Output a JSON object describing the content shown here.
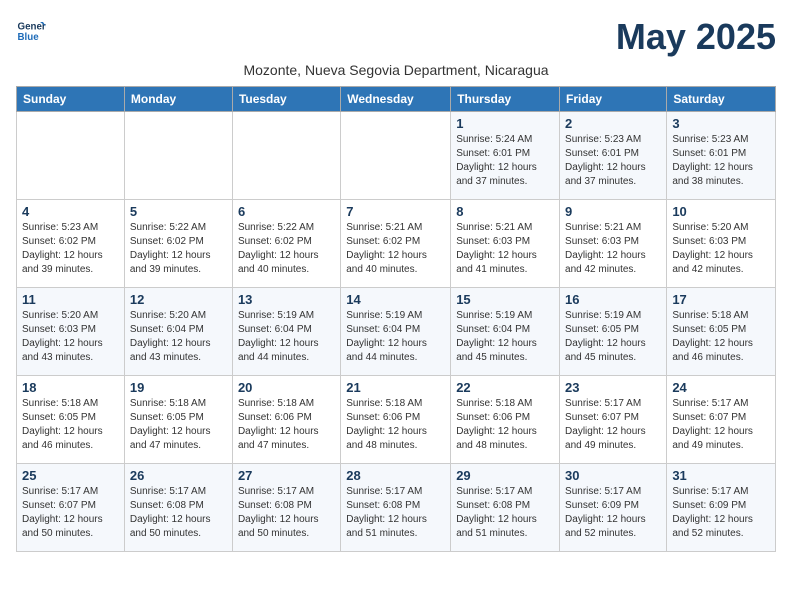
{
  "logo": {
    "line1": "General",
    "line2": "Blue"
  },
  "title": "May 2025",
  "subtitle": "Mozonte, Nueva Segovia Department, Nicaragua",
  "days_of_week": [
    "Sunday",
    "Monday",
    "Tuesday",
    "Wednesday",
    "Thursday",
    "Friday",
    "Saturday"
  ],
  "weeks": [
    [
      {
        "day": "",
        "info": ""
      },
      {
        "day": "",
        "info": ""
      },
      {
        "day": "",
        "info": ""
      },
      {
        "day": "",
        "info": ""
      },
      {
        "day": "1",
        "info": "Sunrise: 5:24 AM\nSunset: 6:01 PM\nDaylight: 12 hours\nand 37 minutes."
      },
      {
        "day": "2",
        "info": "Sunrise: 5:23 AM\nSunset: 6:01 PM\nDaylight: 12 hours\nand 37 minutes."
      },
      {
        "day": "3",
        "info": "Sunrise: 5:23 AM\nSunset: 6:01 PM\nDaylight: 12 hours\nand 38 minutes."
      }
    ],
    [
      {
        "day": "4",
        "info": "Sunrise: 5:23 AM\nSunset: 6:02 PM\nDaylight: 12 hours\nand 39 minutes."
      },
      {
        "day": "5",
        "info": "Sunrise: 5:22 AM\nSunset: 6:02 PM\nDaylight: 12 hours\nand 39 minutes."
      },
      {
        "day": "6",
        "info": "Sunrise: 5:22 AM\nSunset: 6:02 PM\nDaylight: 12 hours\nand 40 minutes."
      },
      {
        "day": "7",
        "info": "Sunrise: 5:21 AM\nSunset: 6:02 PM\nDaylight: 12 hours\nand 40 minutes."
      },
      {
        "day": "8",
        "info": "Sunrise: 5:21 AM\nSunset: 6:03 PM\nDaylight: 12 hours\nand 41 minutes."
      },
      {
        "day": "9",
        "info": "Sunrise: 5:21 AM\nSunset: 6:03 PM\nDaylight: 12 hours\nand 42 minutes."
      },
      {
        "day": "10",
        "info": "Sunrise: 5:20 AM\nSunset: 6:03 PM\nDaylight: 12 hours\nand 42 minutes."
      }
    ],
    [
      {
        "day": "11",
        "info": "Sunrise: 5:20 AM\nSunset: 6:03 PM\nDaylight: 12 hours\nand 43 minutes."
      },
      {
        "day": "12",
        "info": "Sunrise: 5:20 AM\nSunset: 6:04 PM\nDaylight: 12 hours\nand 43 minutes."
      },
      {
        "day": "13",
        "info": "Sunrise: 5:19 AM\nSunset: 6:04 PM\nDaylight: 12 hours\nand 44 minutes."
      },
      {
        "day": "14",
        "info": "Sunrise: 5:19 AM\nSunset: 6:04 PM\nDaylight: 12 hours\nand 44 minutes."
      },
      {
        "day": "15",
        "info": "Sunrise: 5:19 AM\nSunset: 6:04 PM\nDaylight: 12 hours\nand 45 minutes."
      },
      {
        "day": "16",
        "info": "Sunrise: 5:19 AM\nSunset: 6:05 PM\nDaylight: 12 hours\nand 45 minutes."
      },
      {
        "day": "17",
        "info": "Sunrise: 5:18 AM\nSunset: 6:05 PM\nDaylight: 12 hours\nand 46 minutes."
      }
    ],
    [
      {
        "day": "18",
        "info": "Sunrise: 5:18 AM\nSunset: 6:05 PM\nDaylight: 12 hours\nand 46 minutes."
      },
      {
        "day": "19",
        "info": "Sunrise: 5:18 AM\nSunset: 6:05 PM\nDaylight: 12 hours\nand 47 minutes."
      },
      {
        "day": "20",
        "info": "Sunrise: 5:18 AM\nSunset: 6:06 PM\nDaylight: 12 hours\nand 47 minutes."
      },
      {
        "day": "21",
        "info": "Sunrise: 5:18 AM\nSunset: 6:06 PM\nDaylight: 12 hours\nand 48 minutes."
      },
      {
        "day": "22",
        "info": "Sunrise: 5:18 AM\nSunset: 6:06 PM\nDaylight: 12 hours\nand 48 minutes."
      },
      {
        "day": "23",
        "info": "Sunrise: 5:17 AM\nSunset: 6:07 PM\nDaylight: 12 hours\nand 49 minutes."
      },
      {
        "day": "24",
        "info": "Sunrise: 5:17 AM\nSunset: 6:07 PM\nDaylight: 12 hours\nand 49 minutes."
      }
    ],
    [
      {
        "day": "25",
        "info": "Sunrise: 5:17 AM\nSunset: 6:07 PM\nDaylight: 12 hours\nand 50 minutes."
      },
      {
        "day": "26",
        "info": "Sunrise: 5:17 AM\nSunset: 6:08 PM\nDaylight: 12 hours\nand 50 minutes."
      },
      {
        "day": "27",
        "info": "Sunrise: 5:17 AM\nSunset: 6:08 PM\nDaylight: 12 hours\nand 50 minutes."
      },
      {
        "day": "28",
        "info": "Sunrise: 5:17 AM\nSunset: 6:08 PM\nDaylight: 12 hours\nand 51 minutes."
      },
      {
        "day": "29",
        "info": "Sunrise: 5:17 AM\nSunset: 6:08 PM\nDaylight: 12 hours\nand 51 minutes."
      },
      {
        "day": "30",
        "info": "Sunrise: 5:17 AM\nSunset: 6:09 PM\nDaylight: 12 hours\nand 52 minutes."
      },
      {
        "day": "31",
        "info": "Sunrise: 5:17 AM\nSunset: 6:09 PM\nDaylight: 12 hours\nand 52 minutes."
      }
    ]
  ]
}
